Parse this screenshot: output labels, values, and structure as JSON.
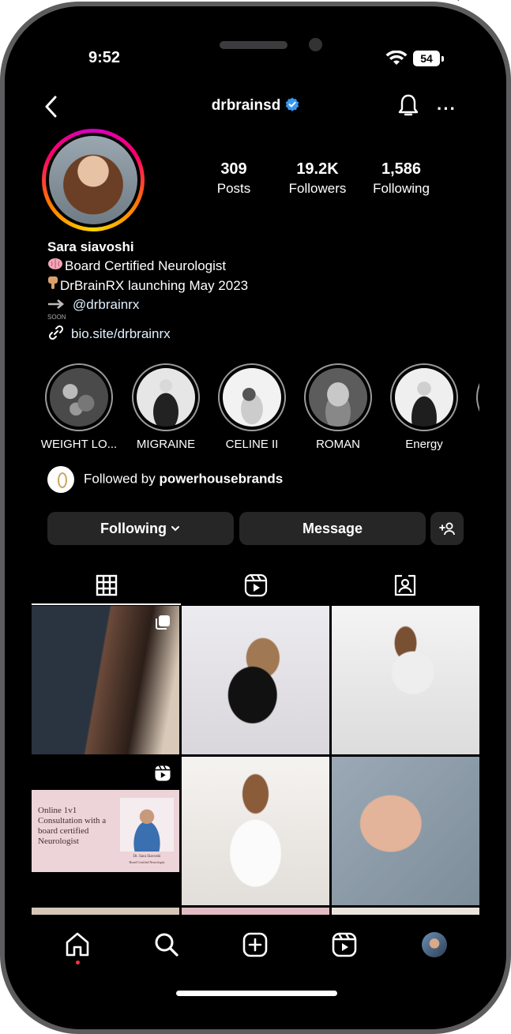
{
  "status_bar": {
    "time": "9:52",
    "battery": "54"
  },
  "header": {
    "username": "drbrainsd"
  },
  "stats": [
    {
      "value": "309",
      "label": "Posts"
    },
    {
      "value": "19.2K",
      "label": "Followers"
    },
    {
      "value": "1,586",
      "label": "Following"
    }
  ],
  "bio": {
    "name": "Sara siavoshi",
    "line1": "Board Certified Neurologist",
    "line2": "DrBrainRX launching May 2023",
    "line3": "@drbrainrx",
    "soon": "SOON",
    "link": "bio.site/drbrainrx"
  },
  "highlights": [
    {
      "label": "WEIGHT LO..."
    },
    {
      "label": "MIGRAINE"
    },
    {
      "label": "CELINE II"
    },
    {
      "label": "ROMAN"
    },
    {
      "label": "Energy"
    }
  ],
  "followed_by": {
    "prefix": "Followed by",
    "account": "powerhousebrands"
  },
  "actions": {
    "following": "Following",
    "message": "Message"
  },
  "post_card": {
    "title": "Online 1v1 Consultation with a board certified Neurologist",
    "caption_name": "Dr. Sara Siavoshi",
    "caption_role": "Board Certified Neurologist"
  },
  "colors": {
    "background": "#000000",
    "button": "#262626",
    "verified": "#3897f0",
    "notification_dot": "#ff3040"
  }
}
